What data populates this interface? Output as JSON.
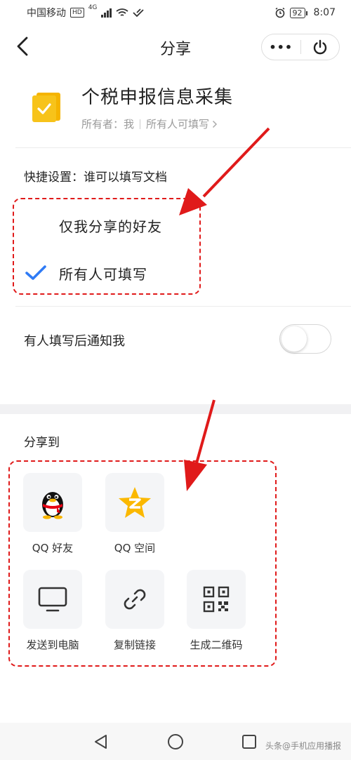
{
  "status_bar": {
    "carrier": "中国移动",
    "hd": "HD",
    "network": "4G",
    "battery": "92",
    "time": "8:07"
  },
  "nav": {
    "title": "分享",
    "more_glyph": "•••",
    "icons": {
      "back": "back-arrow-icon",
      "more": "more-icon",
      "close": "power-icon"
    }
  },
  "document": {
    "title": "个税申报信息采集",
    "owner": "所有者：我",
    "permission": "所有人可填写",
    "icon_color": "#F7C31A"
  },
  "quick_settings": {
    "label": "快捷设置：谁可以填写文档",
    "options": [
      {
        "label": "仅我分享的好友",
        "selected": false
      },
      {
        "label": "所有人可填写",
        "selected": true
      }
    ],
    "check_color": "#2F7BF5"
  },
  "notify": {
    "label": "有人填写后通知我",
    "enabled": false
  },
  "share": {
    "label": "分享到",
    "items": [
      {
        "label": "QQ 好友",
        "icon": "qq-penguin-icon"
      },
      {
        "label": "QQ 空间",
        "icon": "qzone-star-icon"
      },
      {
        "label": "发送到电脑",
        "icon": "monitor-icon"
      },
      {
        "label": "复制链接",
        "icon": "link-icon"
      },
      {
        "label": "生成二维码",
        "icon": "qr-code-icon"
      }
    ]
  },
  "annotation_color": "#E01A1A",
  "watermark": "头条@手机应用播报"
}
